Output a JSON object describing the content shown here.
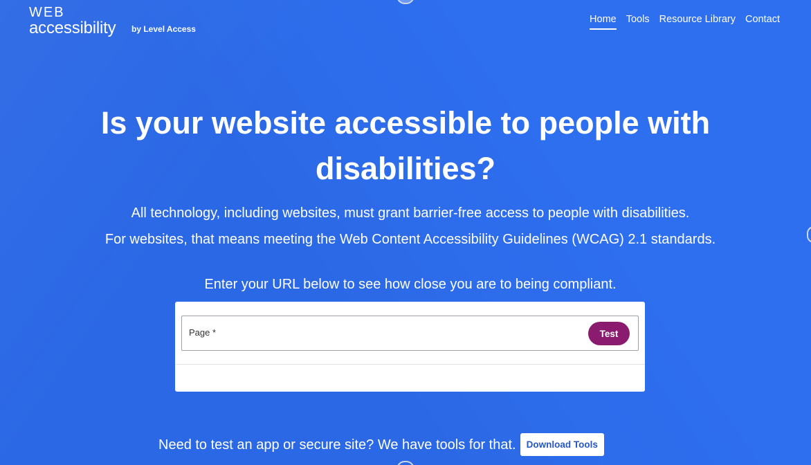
{
  "logo": {
    "web": "WEB",
    "accessibility": "accessibility",
    "by": "by Level Access"
  },
  "nav": {
    "items": [
      {
        "label": "Home",
        "active": true
      },
      {
        "label": "Tools",
        "active": false
      },
      {
        "label": "Resource Library",
        "active": false
      },
      {
        "label": "Contact",
        "active": false
      }
    ]
  },
  "hero": {
    "headline_line1": "Is your website accessible to people with",
    "headline_line2": "disabilities?",
    "sub_line1": "All technology, including websites, must grant barrier-free access to people with disabilities.",
    "sub_line2": "For websites, that means meeting the Web Content Accessibility Guidelines (WCAG) 2.1 standards.",
    "prompt": "Enter your URL below to see how close you are to being compliant."
  },
  "form": {
    "field_label": "Page *",
    "field_value": "",
    "test_label": "Test"
  },
  "bottom": {
    "text": "Need to test an app or secure site? We have tools for that.",
    "download_label": "Download Tools"
  },
  "colors": {
    "background": "#2e6ff0",
    "test_button": "#8b1b6e",
    "download_text": "#2557c7"
  }
}
